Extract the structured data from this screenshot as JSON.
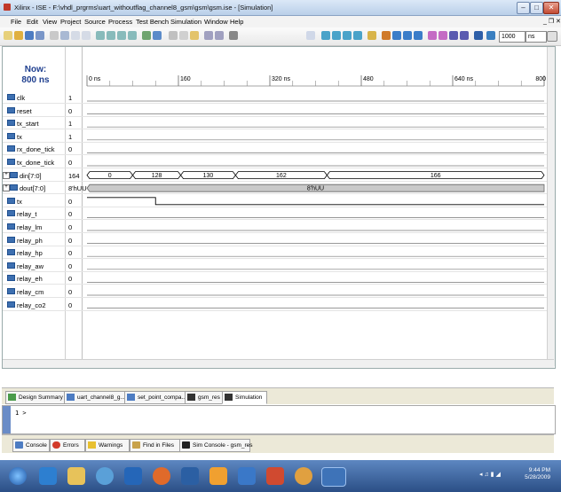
{
  "window": {
    "title": "Xilinx - ISE - F:\\vhdl_prgrms\\uart_withoutflag_channel8_gsm\\gsm\\gsm.ise - [Simulation]"
  },
  "menu": [
    "File",
    "Edit",
    "View",
    "Project",
    "Source",
    "Process",
    "Test Bench",
    "Simulation",
    "Window",
    "Help"
  ],
  "toolbar": {
    "sim_time": "1000",
    "time_unit": "ns"
  },
  "now": {
    "label": "Now:",
    "value": "800 ns"
  },
  "timeline": {
    "ticks": [
      "0 ns",
      "160",
      "320 ns",
      "480",
      "640 ns",
      "800"
    ]
  },
  "signals": [
    {
      "name": "clk",
      "value": "1"
    },
    {
      "name": "reset",
      "value": "0"
    },
    {
      "name": "tx_start",
      "value": "1"
    },
    {
      "name": "tx",
      "value": "1"
    },
    {
      "name": "rx_done_tick",
      "value": "0"
    },
    {
      "name": "tx_done_tick",
      "value": "0"
    },
    {
      "name": "din[7:0]",
      "value": "164"
    },
    {
      "name": "dout[7:0]",
      "value": "8'hUU"
    },
    {
      "name": "tx",
      "value": "0"
    },
    {
      "name": "relay_t",
      "value": "0"
    },
    {
      "name": "relay_lm",
      "value": "0"
    },
    {
      "name": "relay_ph",
      "value": "0"
    },
    {
      "name": "relay_hp",
      "value": "0"
    },
    {
      "name": "relay_aw",
      "value": "0"
    },
    {
      "name": "relay_eh",
      "value": "0"
    },
    {
      "name": "relay_cm",
      "value": "0"
    },
    {
      "name": "relay_co2",
      "value": "0"
    }
  ],
  "bus_din": {
    "segments": [
      "0",
      "128",
      "130",
      "162",
      "166"
    ]
  },
  "bus_dout": {
    "label": "8'hUU"
  },
  "doc_tabs": [
    "Design Summary",
    "uart_channel8_g...",
    "set_point_compa...",
    "gsm_res",
    "Simulation"
  ],
  "console": {
    "prompt": "1 >"
  },
  "console_tabs": [
    "Console",
    "Errors",
    "Warnings",
    "Find in Files",
    "Sim Console - gsm_res"
  ],
  "clock": {
    "time": "9:44 PM",
    "date": "5/28/2009"
  }
}
